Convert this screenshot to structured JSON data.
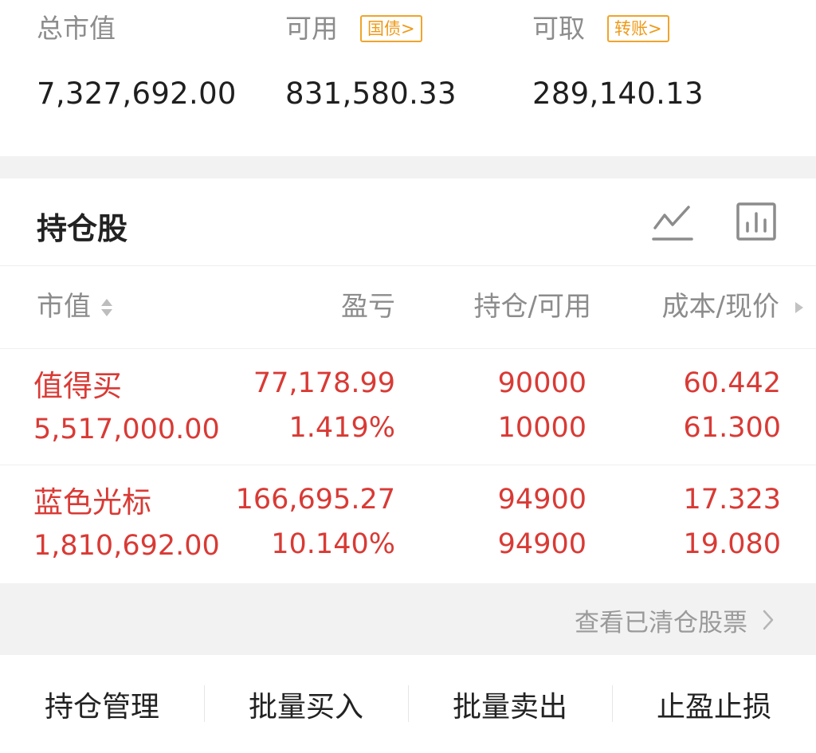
{
  "summary": {
    "total_market_value_label": "总市值",
    "total_market_value": "7,327,692.00",
    "available_label": "可用",
    "available_tag": "国债>",
    "available_value": "831,580.33",
    "withdrawable_label": "可取",
    "withdrawable_tag": "转账>",
    "withdrawable_value": "289,140.13"
  },
  "holdings": {
    "title": "持仓股",
    "columns": {
      "market_value": "市值",
      "profit_loss": "盈亏",
      "position_available": "持仓/可用",
      "cost_price": "成本/现价"
    },
    "rows": [
      {
        "name": "值得买",
        "market_value": "5,517,000.00",
        "profit_loss": "77,178.99",
        "profit_loss_pct": "1.419%",
        "position": "90000",
        "available": "10000",
        "cost": "60.442",
        "price": "61.300"
      },
      {
        "name": "蓝色光标",
        "market_value": "1,810,692.00",
        "profit_loss": "166,695.27",
        "profit_loss_pct": "10.140%",
        "position": "94900",
        "available": "94900",
        "cost": "17.323",
        "price": "19.080"
      }
    ],
    "cleared_link": "查看已清仓股票"
  },
  "actions": {
    "manage": "持仓管理",
    "batch_buy": "批量买入",
    "batch_sell": "批量卖出",
    "stop_profit_loss": "止盈止损"
  },
  "colors": {
    "profit_red": "#d93a35",
    "tag_orange": "#ee9a18",
    "muted_gray": "#8c8c8c"
  }
}
